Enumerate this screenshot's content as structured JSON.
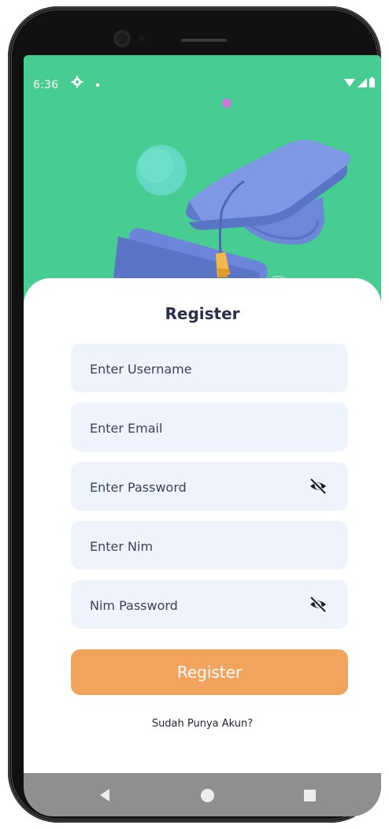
{
  "status_bar": {
    "time": "6:36",
    "gear_icon": "settings-icon",
    "wifi_icon": "wifi-icon",
    "signal_icon": "signal-icon",
    "battery_icon": "battery-icon"
  },
  "hero": {
    "illustration": "graduation-cap-illustration",
    "background_color": "#47cd91"
  },
  "form": {
    "title": "Register",
    "username_placeholder": "Enter Username",
    "email_placeholder": "Enter Email",
    "password_placeholder": "Enter Password",
    "nim_placeholder": "Enter Nim",
    "nim_password_placeholder": "Nim Password",
    "visibility_icon": "eye-off-icon",
    "submit_label": "Register",
    "login_link": "Sudah Punya Akun?"
  },
  "colors": {
    "accent_button": "#f2a45f",
    "field_background": "#eef3fc",
    "title_text": "#2a2f4e"
  },
  "nav_bar": {
    "back_icon": "back-triangle-icon",
    "home_icon": "home-circle-icon",
    "recents_icon": "recents-square-icon"
  }
}
